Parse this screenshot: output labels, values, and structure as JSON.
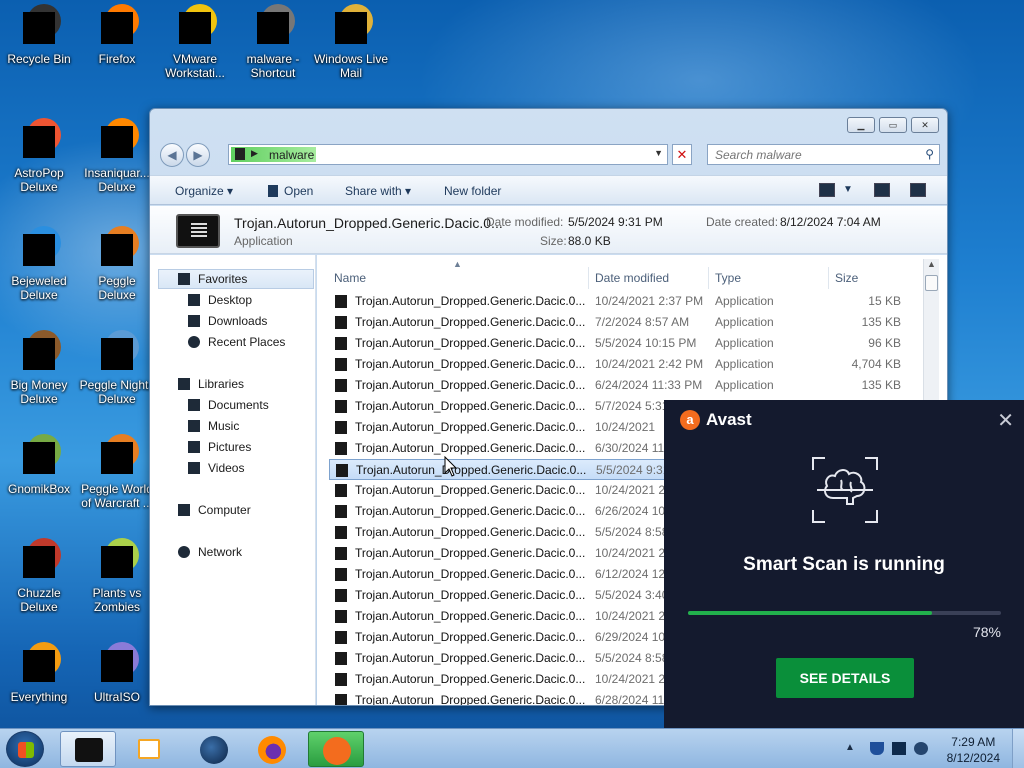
{
  "desktop_icons": [
    {
      "label": "Recycle Bin",
      "icon": "recycle-bin-icon"
    },
    {
      "label": "Firefox",
      "icon": "firefox-icon"
    },
    {
      "label": "VMware Workstati...",
      "icon": "vmware-icon"
    },
    {
      "label": "malware - Shortcut",
      "icon": "folder-shortcut-icon"
    },
    {
      "label": "Windows Live Mail",
      "icon": "mail-icon"
    },
    {
      "label": "AstroPop Deluxe",
      "icon": "game-icon"
    },
    {
      "label": "Insaniquar... Deluxe",
      "icon": "game-icon"
    },
    {
      "label": "Bejeweled Deluxe",
      "icon": "game-icon"
    },
    {
      "label": "Peggle Deluxe",
      "icon": "game-icon"
    },
    {
      "label": "Big Money Deluxe",
      "icon": "game-icon"
    },
    {
      "label": "Peggle Nights Deluxe",
      "icon": "game-icon"
    },
    {
      "label": "GnomikBox",
      "icon": "game-icon"
    },
    {
      "label": "Peggle World of Warcraft ...",
      "icon": "game-icon"
    },
    {
      "label": "Chuzzle Deluxe",
      "icon": "game-icon"
    },
    {
      "label": "Plants vs Zombies",
      "icon": "game-icon"
    },
    {
      "label": "Everything",
      "icon": "search-app-icon"
    },
    {
      "label": "UltraISO",
      "icon": "disc-icon"
    }
  ],
  "explorer": {
    "address": "malware",
    "search_placeholder": "Search malware",
    "toolbar": {
      "organize": "Organize",
      "open": "Open",
      "share_with": "Share with",
      "new_folder": "New folder"
    },
    "details": {
      "name": "Trojan.Autorun_Dropped.Generic.Dacic.0...",
      "type": "Application",
      "date_modified_label": "Date modified:",
      "date_modified": "5/5/2024 9:31 PM",
      "date_created_label": "Date created:",
      "date_created": "8/12/2024 7:04 AM",
      "size_label": "Size:",
      "size": "88.0 KB"
    },
    "nav": {
      "favorites": "Favorites",
      "desktop": "Desktop",
      "downloads": "Downloads",
      "recent_places": "Recent Places",
      "libraries": "Libraries",
      "documents": "Documents",
      "music": "Music",
      "pictures": "Pictures",
      "videos": "Videos",
      "computer": "Computer",
      "network": "Network"
    },
    "columns": {
      "name": "Name",
      "date": "Date modified",
      "type": "Type",
      "size": "Size"
    },
    "files": [
      {
        "name": "Trojan.Autorun_Dropped.Generic.Dacic.0...",
        "date": "10/24/2021 2:37 PM",
        "type": "Application",
        "size": "15 KB"
      },
      {
        "name": "Trojan.Autorun_Dropped.Generic.Dacic.0...",
        "date": "7/2/2024 8:57 AM",
        "type": "Application",
        "size": "135 KB"
      },
      {
        "name": "Trojan.Autorun_Dropped.Generic.Dacic.0...",
        "date": "5/5/2024 10:15 PM",
        "type": "Application",
        "size": "96 KB"
      },
      {
        "name": "Trojan.Autorun_Dropped.Generic.Dacic.0...",
        "date": "10/24/2021 2:42 PM",
        "type": "Application",
        "size": "4,704 KB"
      },
      {
        "name": "Trojan.Autorun_Dropped.Generic.Dacic.0...",
        "date": "6/24/2024 11:33 PM",
        "type": "Application",
        "size": "135 KB"
      },
      {
        "name": "Trojan.Autorun_Dropped.Generic.Dacic.0...",
        "date": "5/7/2024 5:31 PM",
        "type": "Application",
        "size": "85 KB"
      },
      {
        "name": "Trojan.Autorun_Dropped.Generic.Dacic.0...",
        "date": "10/24/2021",
        "type": "",
        "size": ""
      },
      {
        "name": "Trojan.Autorun_Dropped.Generic.Dacic.0...",
        "date": "6/30/2024 11:",
        "type": "",
        "size": ""
      },
      {
        "name": "Trojan.Autorun_Dropped.Generic.Dacic.0...",
        "date": "5/5/2024 9:31",
        "type": "",
        "size": ""
      },
      {
        "name": "Trojan.Autorun_Dropped.Generic.Dacic.0...",
        "date": "10/24/2021 2:",
        "type": "",
        "size": ""
      },
      {
        "name": "Trojan.Autorun_Dropped.Generic.Dacic.0...",
        "date": "6/26/2024 10:",
        "type": "",
        "size": ""
      },
      {
        "name": "Trojan.Autorun_Dropped.Generic.Dacic.0...",
        "date": "5/5/2024 8:58",
        "type": "",
        "size": ""
      },
      {
        "name": "Trojan.Autorun_Dropped.Generic.Dacic.0...",
        "date": "10/24/2021 2:",
        "type": "",
        "size": ""
      },
      {
        "name": "Trojan.Autorun_Dropped.Generic.Dacic.0...",
        "date": "6/12/2024 12:",
        "type": "",
        "size": ""
      },
      {
        "name": "Trojan.Autorun_Dropped.Generic.Dacic.0...",
        "date": "5/5/2024 3:40",
        "type": "",
        "size": ""
      },
      {
        "name": "Trojan.Autorun_Dropped.Generic.Dacic.0...",
        "date": "10/24/2021 2:",
        "type": "",
        "size": ""
      },
      {
        "name": "Trojan.Autorun_Dropped.Generic.Dacic.0...",
        "date": "6/29/2024 10:",
        "type": "",
        "size": ""
      },
      {
        "name": "Trojan.Autorun_Dropped.Generic.Dacic.0...",
        "date": "5/5/2024 8:58",
        "type": "",
        "size": ""
      },
      {
        "name": "Trojan.Autorun_Dropped.Generic.Dacic.0...",
        "date": "10/24/2021 2:",
        "type": "",
        "size": ""
      },
      {
        "name": "Trojan.Autorun_Dropped.Generic.Dacic.0...",
        "date": "6/28/2024 11:",
        "type": "",
        "size": ""
      }
    ],
    "selected_index": 8
  },
  "avast": {
    "brand": "Avast",
    "title": "Smart Scan is running",
    "progress_percent": 78,
    "progress_label": "78%",
    "button": "SEE DETAILS",
    "accent": "#f36c1e",
    "progress_color": "#22b14c"
  },
  "taskbar": {
    "time": "7:29 AM",
    "date": "8/12/2024"
  }
}
